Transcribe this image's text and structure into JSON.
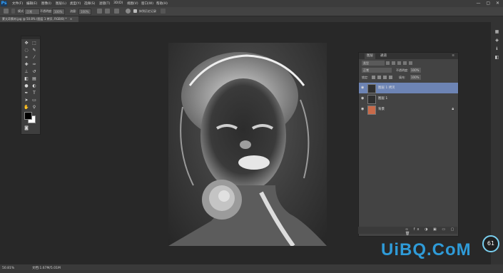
{
  "app": {
    "logo": "Ps"
  },
  "menu": [
    "文件(F)",
    "编辑(E)",
    "图像(I)",
    "图层(L)",
    "类型(Y)",
    "选择(S)",
    "滤镜(T)",
    "3D(D)",
    "视图(V)",
    "窗口(W)",
    "帮助(H)"
  ],
  "window_controls": "— ▢ ✕",
  "options": {
    "mode_label": "模式:",
    "mode_value": "正常",
    "opacity_label": "不透明度:",
    "opacity_value": "100%",
    "flow_label": "流量:",
    "flow_value": "100%",
    "erase_history": "抹到历史记录"
  },
  "document_tab": {
    "title": "蒙太奇素材.jpg @ 50.8% (图层 1 拷贝, RGB/8) *",
    "close": "×"
  },
  "layers_panel": {
    "tabs": [
      "图层",
      "通道"
    ],
    "filter_kind": "类型",
    "blend_mode": "正常",
    "opacity_label": "不透明度:",
    "opacity_value": "100%",
    "lock_label": "锁定:",
    "fill_label": "填充:",
    "fill_value": "100%",
    "layers": [
      {
        "name": "图层 1 拷贝",
        "selected": true
      },
      {
        "name": "图层 1",
        "selected": false
      },
      {
        "name": "背景",
        "selected": false,
        "locked": true
      }
    ]
  },
  "status": {
    "zoom": "50.81%",
    "doc": "文档:1.67M/5.01M"
  },
  "watermark": {
    "text": "UiBQ.CoM"
  },
  "perf_badge": "61",
  "colors": {
    "accent": "#6d84b4",
    "watermark": "#2f9bd8"
  }
}
